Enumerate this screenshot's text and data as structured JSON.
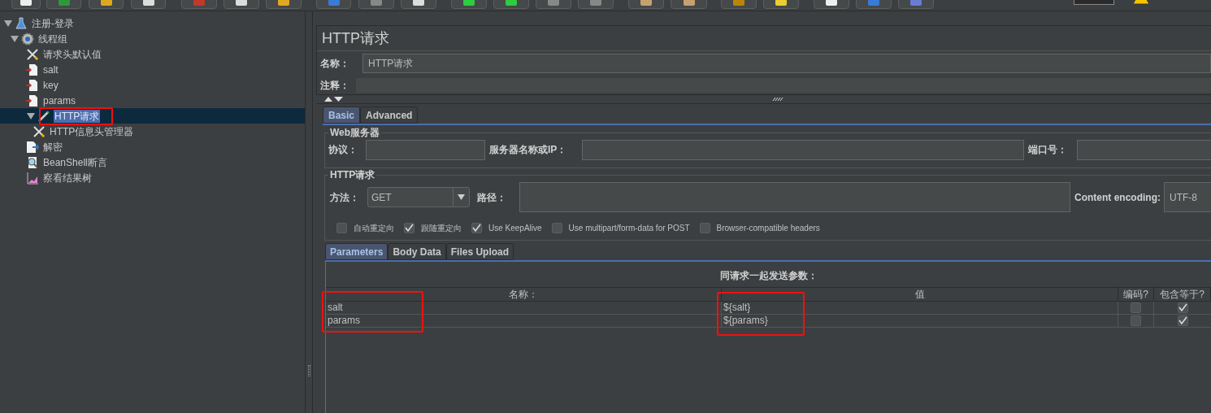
{
  "tree": [
    {
      "label": "注册-登录",
      "kind": "flask",
      "expanded": true,
      "selected": false,
      "children": [
        {
          "label": "线程组",
          "kind": "gear",
          "expanded": true,
          "selected": false,
          "children": [
            {
              "label": "请求头默认值",
              "kind": "tools",
              "selected": false
            },
            {
              "label": "salt",
              "kind": "doc-arrow",
              "selected": false
            },
            {
              "label": "key",
              "kind": "doc-arrow",
              "selected": false
            },
            {
              "label": "params",
              "kind": "doc-arrow",
              "selected": false
            },
            {
              "label": "HTTP请求",
              "kind": "pen",
              "expanded": true,
              "selected": true,
              "children": [
                {
                  "label": "HTTP信息头管理器",
                  "kind": "tools",
                  "selected": false
                }
              ]
            },
            {
              "label": "解密",
              "kind": "doc-blue-arrow",
              "selected": false
            },
            {
              "label": "BeanShell断言",
              "kind": "magnifier",
              "selected": false
            },
            {
              "label": "察看结果树",
              "kind": "chart",
              "selected": false
            }
          ]
        }
      ]
    }
  ],
  "panel": {
    "title": "HTTP请求",
    "name_label": "名称：",
    "name_value": "HTTP请求",
    "comment_label": "注释：",
    "tabs": [
      {
        "label": "Basic",
        "selected": true
      },
      {
        "label": "Advanced",
        "selected": false
      }
    ],
    "web_server": {
      "legend": "Web服务器",
      "protocol_label": "协议：",
      "server_label": "服务器名称或IP：",
      "port_label": "端口号："
    },
    "http_request": {
      "legend": "HTTP请求",
      "method_label": "方法：",
      "method_value": "GET",
      "path_label": "路径：",
      "encoding_label": "Content encoding:",
      "encoding_value": "UTF-8",
      "options": [
        {
          "label": "自动重定向",
          "checked": false
        },
        {
          "label": "跟随重定向",
          "checked": true
        },
        {
          "label": "Use KeepAlive",
          "checked": true
        },
        {
          "label": "Use multipart/form-data for POST",
          "checked": false
        },
        {
          "label": "Browser-compatible headers",
          "checked": false
        }
      ]
    },
    "sub_tabs": [
      {
        "label": "Parameters",
        "selected": true
      },
      {
        "label": "Body Data",
        "selected": false
      },
      {
        "label": "Files Upload",
        "selected": false
      }
    ],
    "params_title": "同请求一起发送参数：",
    "columns": [
      "名称：",
      "值",
      "编码?",
      "包含等于?"
    ],
    "rows": [
      {
        "name": "salt",
        "value": "${salt}",
        "encode": false,
        "include_equals": true
      },
      {
        "name": "params",
        "value": "${params}",
        "encode": false,
        "include_equals": true
      }
    ]
  }
}
